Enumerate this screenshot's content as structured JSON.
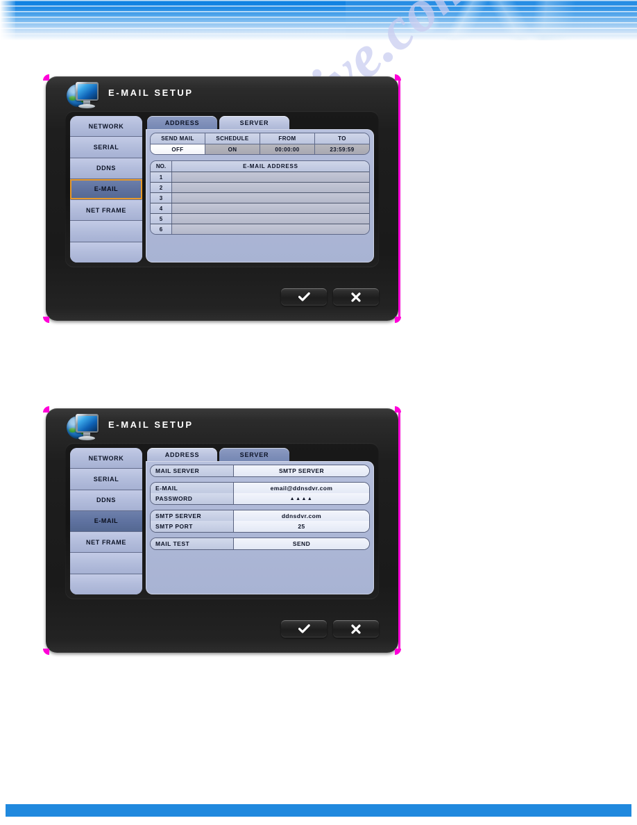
{
  "page": {
    "watermark": "manualshive.com"
  },
  "dialogs": [
    {
      "title": "E-MAIL SETUP",
      "icon": "globe-monitor-icon",
      "sidebar": {
        "items": [
          {
            "label": "NETWORK",
            "selected": false
          },
          {
            "label": "SERIAL",
            "selected": false
          },
          {
            "label": "DDNS",
            "selected": false
          },
          {
            "label": "E-MAIL",
            "selected": true
          },
          {
            "label": "NET FRAME",
            "selected": false
          },
          {
            "label": "",
            "selected": false
          },
          {
            "label": "",
            "selected": false
          }
        ],
        "focused_index": 3
      },
      "tabs": [
        {
          "label": "ADDRESS",
          "active": true
        },
        {
          "label": "SERVER",
          "active": false
        }
      ],
      "settings_grid": {
        "headers": [
          "SEND MAIL",
          "SCHEDULE",
          "FROM",
          "TO"
        ],
        "values": [
          "OFF",
          "ON",
          "00:00:00",
          "23:59:59"
        ],
        "highlighted_index": 0
      },
      "address_table": {
        "headers": [
          "NO.",
          "E-MAIL ADDRESS"
        ],
        "rows": [
          {
            "no": "1",
            "address": ""
          },
          {
            "no": "2",
            "address": ""
          },
          {
            "no": "3",
            "address": ""
          },
          {
            "no": "4",
            "address": ""
          },
          {
            "no": "5",
            "address": ""
          },
          {
            "no": "6",
            "address": ""
          }
        ]
      },
      "buttons": {
        "confirm": "check-icon",
        "cancel": "close-icon"
      }
    },
    {
      "title": "E-MAIL SETUP",
      "icon": "globe-monitor-icon",
      "sidebar": {
        "items": [
          {
            "label": "NETWORK",
            "selected": false
          },
          {
            "label": "SERIAL",
            "selected": false
          },
          {
            "label": "DDNS",
            "selected": false
          },
          {
            "label": "E-MAIL",
            "selected": true
          },
          {
            "label": "NET FRAME",
            "selected": false
          },
          {
            "label": "",
            "selected": false
          },
          {
            "label": "",
            "selected": false
          }
        ],
        "focused_index": -1
      },
      "tabs": [
        {
          "label": "ADDRESS",
          "active": false
        },
        {
          "label": "SERVER",
          "active": true
        }
      ],
      "field_groups": [
        {
          "fields": [
            {
              "label": "MAIL SERVER",
              "value": "SMTP SERVER",
              "masked": false
            }
          ]
        },
        {
          "fields": [
            {
              "label": "E-MAIL",
              "value": "email@ddnsdvr.com",
              "masked": false
            },
            {
              "label": "PASSWORD",
              "value": "▲▲▲▲",
              "masked": true
            }
          ]
        },
        {
          "fields": [
            {
              "label": "SMTP SERVER",
              "value": "ddnsdvr.com",
              "masked": false
            },
            {
              "label": "SMTP PORT",
              "value": "25",
              "masked": false
            }
          ]
        },
        {
          "fields": [
            {
              "label": "MAIL TEST",
              "value": "SEND",
              "masked": false
            }
          ]
        }
      ],
      "buttons": {
        "confirm": "check-icon",
        "cancel": "close-icon"
      }
    }
  ]
}
